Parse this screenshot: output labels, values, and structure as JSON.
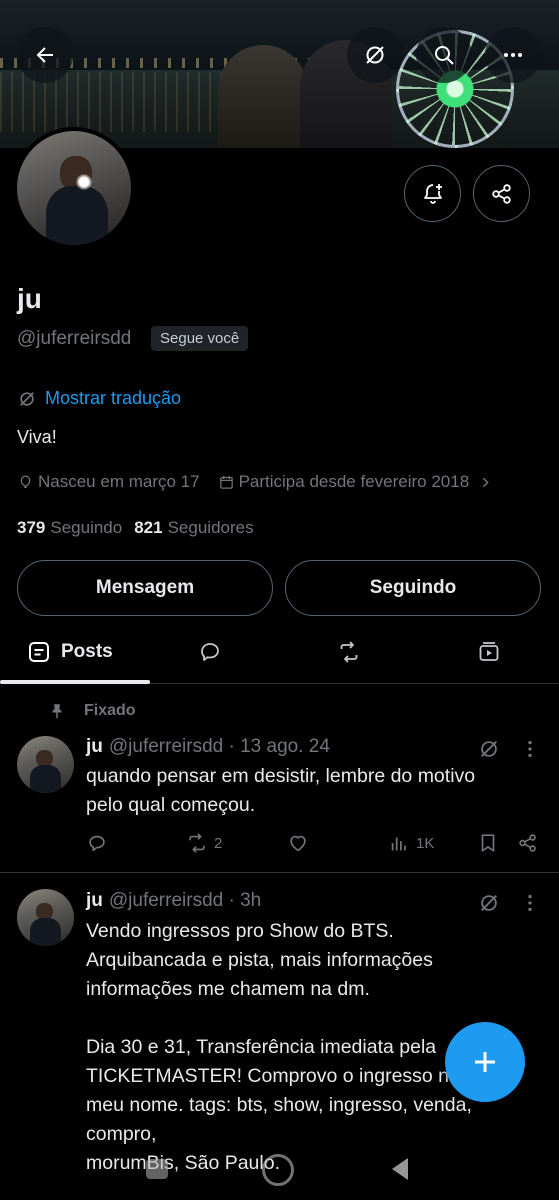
{
  "profile": {
    "display_name": "ju",
    "handle": "@juferreirsdd",
    "follows_you_badge": "Segue você",
    "translate_link": "Mostrar tradução",
    "bio": "Viva!",
    "birth": "Nasceu em março 17",
    "joined": "Participa desde fevereiro 2018",
    "following_count": "379",
    "following_label": "Seguindo",
    "followers_count": "821",
    "followers_label": "Seguidores",
    "message_button": "Mensagem",
    "following_button": "Seguindo"
  },
  "tabs": {
    "posts_label": "Posts"
  },
  "posts": [
    {
      "pinned_label": "Fixado",
      "name": "ju",
      "handle": "@juferreirsdd",
      "time": "· 13 ago. 24",
      "text": "quando pensar em desistir, lembre do motivo\npelo qual começou.",
      "reposts": "2",
      "views": "1K"
    },
    {
      "name": "ju",
      "handle": "@juferreirsdd",
      "time": "· 3h",
      "text": "Vendo ingressos pro Show do BTS.\nArquibancada e pista, mais informações\ninformações me chamem na dm.\n\nDia 30 e 31,  Transferência imediata pela\nTICKETMASTER!  Comprovo o ingresso no\nmeu nome.  tags: bts, show, ingresso, venda,\ncompro,\nmorumBis, São Paulo."
    }
  ],
  "colors": {
    "background": "#000000",
    "accent": "#1d9bf0",
    "text_primary": "#e7e9ea",
    "text_secondary": "#71767b",
    "border": "#2f3336"
  },
  "icons": {
    "back": "arrow-left-icon",
    "grok": "grok-icon",
    "search": "search-icon",
    "more": "more-dots-icon",
    "notify": "bell-plus-icon",
    "share": "share-icon",
    "birthday": "balloon-icon",
    "calendar": "calendar-icon",
    "replies_tab": "speech-bubble-icon",
    "reposts_tab": "repost-icon",
    "media_tab": "media-icon",
    "pin": "pin-icon",
    "reply": "reply-icon",
    "repost": "repost-icon",
    "like": "heart-icon",
    "views": "views-icon",
    "bookmark": "bookmark-icon",
    "compose": "plus-icon"
  }
}
